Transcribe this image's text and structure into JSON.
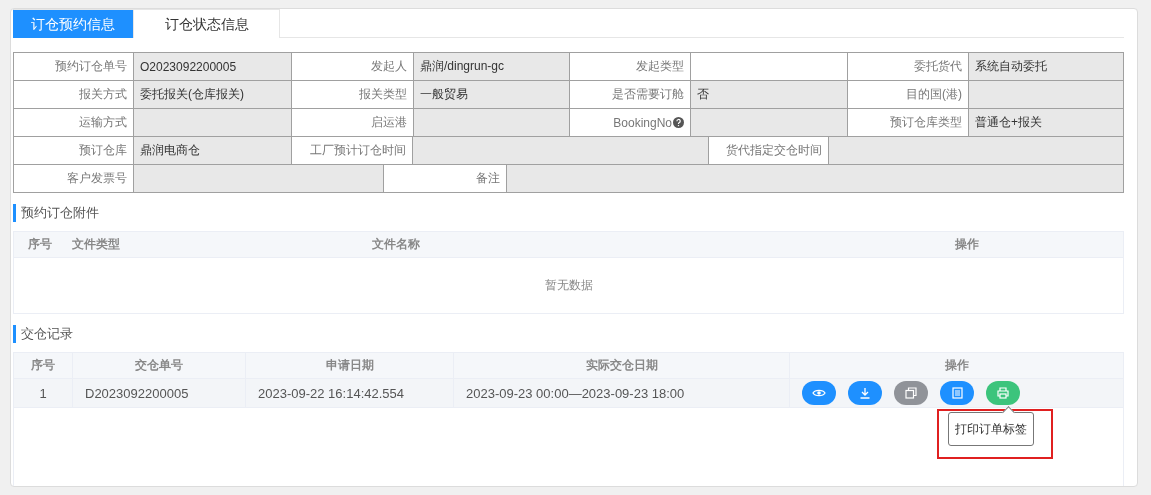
{
  "tabs": [
    {
      "label": "订仓预约信息",
      "selected": true
    },
    {
      "label": "订仓状态信息",
      "selected": false
    }
  ],
  "info_rows": [
    {
      "cells": [
        {
          "label": "预约订仓单号",
          "value": "O2023092200005",
          "disabled": true
        },
        {
          "label": "发起人",
          "value": "鼎润/dingrun-gc",
          "disabled": true
        },
        {
          "label": "发起类型",
          "disabled": false
        },
        {
          "label": "委托货代",
          "value": "系统自动委托",
          "disabled": true
        }
      ]
    },
    {
      "cells": [
        {
          "label": "报关方式",
          "value": "委托报关(仓库报关)",
          "disabled": true
        },
        {
          "label": "报关类型",
          "value": "一般贸易",
          "disabled": true
        },
        {
          "label": "是否需要订舱",
          "value": "否",
          "disabled": true
        },
        {
          "label": "目的国(港)",
          "disabled": true
        }
      ]
    },
    {
      "cells": [
        {
          "label": "运输方式",
          "disabled": true
        },
        {
          "label": "启运港",
          "disabled": true
        },
        {
          "label": "BookingNo",
          "help": true,
          "disabled": true
        },
        {
          "label": "预订仓库类型",
          "value": "普通仓+报关",
          "disabled": true
        }
      ]
    },
    {
      "cells": [
        {
          "label": "预订仓库",
          "value": "鼎润电商仓",
          "disabled": true
        },
        {
          "label": "工厂预计订仓时间",
          "disabled": true
        },
        {
          "label": "货代指定交仓时间",
          "disabled": true
        }
      ]
    },
    {
      "cells": [
        {
          "label": "客户发票号",
          "disabled": true
        },
        {
          "label": "备注",
          "disabled": true
        }
      ]
    }
  ],
  "attachments": {
    "title": "预约订仓附件",
    "columns": [
      "序号",
      "文件类型",
      "文件名称",
      "操作"
    ],
    "empty_text": "暂无数据"
  },
  "records": {
    "title": "交仓记录",
    "columns": [
      "序号",
      "交仓单号",
      "申请日期",
      "实际交仓日期",
      "操作"
    ],
    "rows": [
      {
        "cells": [
          "1",
          "D2023092200005",
          "2023-09-22 16:14:42.554",
          "2023-09-23 00:00—2023-09-23 18:00"
        ],
        "actions": [
          {
            "kind": "view",
            "color": "#1e90ff"
          },
          {
            "kind": "download",
            "color": "#1e90ff"
          },
          {
            "kind": "copy",
            "color": "#909399"
          },
          {
            "kind": "document",
            "color": "#1e90ff"
          },
          {
            "kind": "print",
            "color": "#3cc47c",
            "tooltip": "打印订单标签",
            "highlighted": true
          }
        ]
      }
    ]
  }
}
